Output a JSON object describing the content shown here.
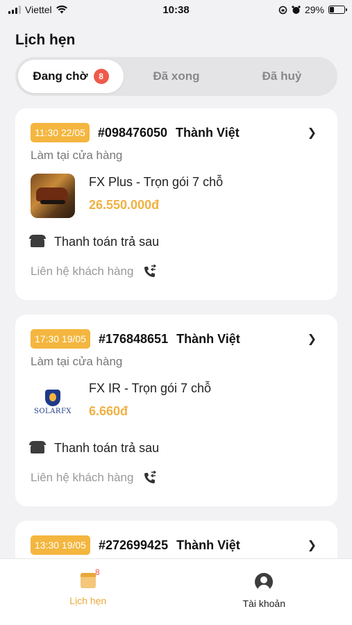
{
  "status_bar": {
    "carrier": "Viettel",
    "time": "10:38",
    "battery": "29%"
  },
  "page_title": "Lịch hẹn",
  "tabs": [
    {
      "label": "Đang chờ",
      "badge": "8",
      "active": true
    },
    {
      "label": "Đã xong",
      "active": false
    },
    {
      "label": "Đã huỷ",
      "active": false
    }
  ],
  "appointments": [
    {
      "time": "11:30 22/05",
      "order_no": "#098476050",
      "customer": "Thành Việt",
      "location": "Làm tại cửa hàng",
      "product_name": "FX Plus - Trọn gói 7 chỗ",
      "price": "26.550.000đ",
      "payment": "Thanh toán trả sau",
      "contact": "Liên hệ khách hàng"
    },
    {
      "time": "17:30 19/05",
      "order_no": "#176848651",
      "customer": "Thành Việt",
      "location": "Làm tại cửa hàng",
      "product_name": "FX IR - Trọn gói 7 chỗ",
      "price": "6.660đ",
      "logo_text": "SOLARFX",
      "payment": "Thanh toán trả sau",
      "contact": "Liên hệ khách hàng"
    },
    {
      "time": "13:30 19/05",
      "order_no": "#272699425",
      "customer": "Thành Việt"
    }
  ],
  "bottom_nav": [
    {
      "label": "Lịch hẹn",
      "badge": "8",
      "icon": "calendar-icon",
      "active": true
    },
    {
      "label": "Tài khoản",
      "icon": "user-icon",
      "active": false
    }
  ],
  "colors": {
    "accent": "#f4b63f",
    "badge": "#ef5a4b",
    "price": "#f0b142"
  }
}
